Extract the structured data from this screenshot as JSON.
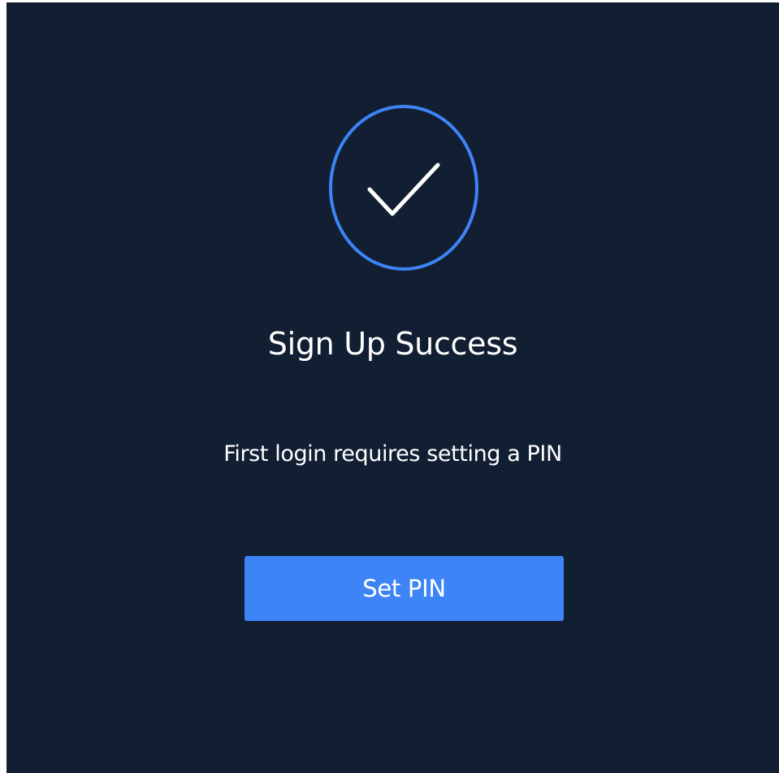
{
  "dialog": {
    "icon": "checkmark-circle-icon",
    "title": "Sign Up Success",
    "message": "First login requires setting a PIN",
    "button_label": "Set PIN"
  },
  "colors": {
    "background": "#121f33",
    "accent": "#3d84f7",
    "text": "#ffffff"
  }
}
